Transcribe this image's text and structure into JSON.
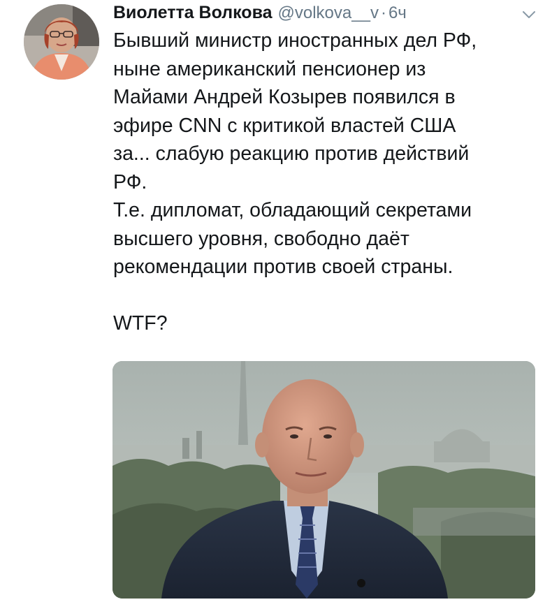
{
  "tweet": {
    "author_name": "Виолетта Волкова",
    "handle": "@volkova__v",
    "separator": "·",
    "time": "6ч",
    "text_lines": [
      "Бывший министр иностранных дел РФ,",
      "ныне американский пенсионер из",
      "Майами Андрей Козырев появился в",
      "эфире CNN с критикой властей США",
      "за... слабую реакцию против действий",
      "РФ.",
      "Т.е. дипломат, обладающий секретами",
      "высшего уровня, свободно даёт",
      "рекомендации против своей страны.",
      "",
      "WTF?"
    ],
    "icons": {
      "avatar": "user-avatar",
      "menu": "chevron-down-icon"
    },
    "media": {
      "type": "photo"
    },
    "colors": {
      "text": "#14171a",
      "secondary": "#657786"
    }
  }
}
